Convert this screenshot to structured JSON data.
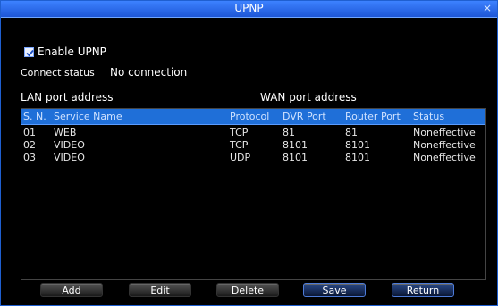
{
  "window": {
    "title": "UPNP",
    "close_glyph": "×"
  },
  "enable": {
    "label": "Enable UPNP",
    "checked": true
  },
  "connect_status": {
    "label": "Connect status",
    "value": "No connection"
  },
  "sections": {
    "lan": "LAN port address",
    "wan": "WAN port address"
  },
  "table": {
    "headers": {
      "sn": "S. N.",
      "name": "Service Name",
      "protocol": "Protocol",
      "dvr_port": "DVR  Port",
      "router_port": "Router  Port",
      "status": "Status"
    },
    "rows": [
      {
        "sn": "01",
        "name": "WEB",
        "protocol": "TCP",
        "dvr_port": "81",
        "router_port": "81",
        "status": "Noneffective"
      },
      {
        "sn": "02",
        "name": "VIDEO",
        "protocol": "TCP",
        "dvr_port": "8101",
        "router_port": "8101",
        "status": "Noneffective"
      },
      {
        "sn": "03",
        "name": "VIDEO",
        "protocol": "UDP",
        "dvr_port": "8101",
        "router_port": "8101",
        "status": "Noneffective"
      }
    ]
  },
  "buttons": {
    "add": "Add",
    "edit": "Edit",
    "delete": "Delete",
    "save": "Save",
    "return": "Return"
  },
  "colors": {
    "titlebar": "#1d56d6",
    "header_row": "#1f6fd8"
  }
}
